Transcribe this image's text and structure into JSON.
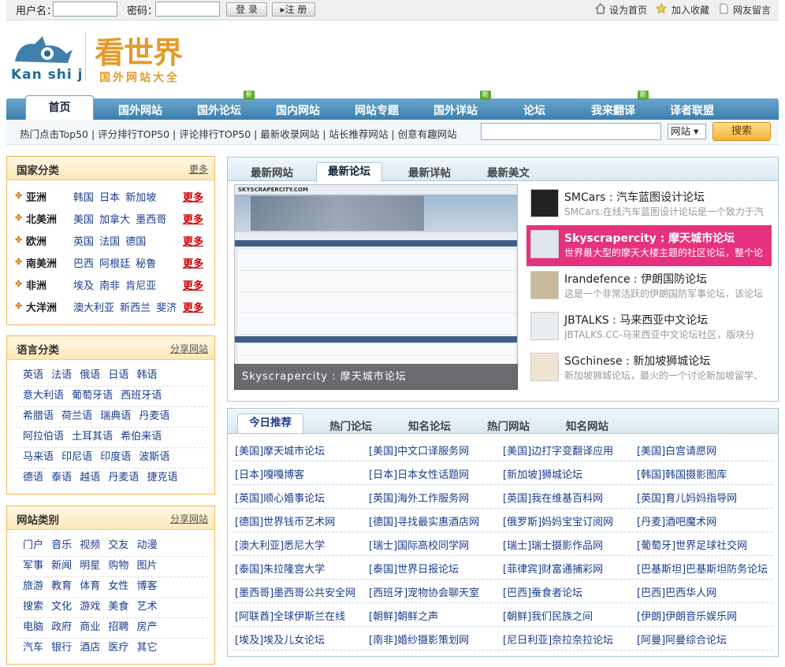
{
  "topbar": {
    "username_label": "用户名：",
    "password_label": "密码：",
    "login_btn": "登 录",
    "register_btn": "▸注 册",
    "set_home": "设为首页",
    "favorite": "加入收藏",
    "guestbook": "网友留言"
  },
  "logo": {
    "en": "Kan shi j",
    "cn": "看世界",
    "sub": "国外网站大全"
  },
  "nav": {
    "home": "首页",
    "items": [
      "国外网站",
      "国外论坛",
      "国内网站",
      "网站专题",
      "国外详站",
      "论坛",
      "我来翻译",
      "译者联盟"
    ],
    "new_tag": "新"
  },
  "subnav": {
    "links": "热门点击Top50 | 评分排行TOP50 | 评论排行TOP50 | 最新收录网站 | 站长推荐网站 | 创意有趣网站",
    "select": "网站 ▾",
    "search_btn": "搜索"
  },
  "country_box": {
    "title": "国家分类",
    "more": "更多",
    "rows": [
      {
        "region": "亚洲",
        "countries": "韩国 日本 新加坡",
        "more": "更多"
      },
      {
        "region": "北美洲",
        "countries": "美国 加拿大 墨西哥",
        "more": "更多"
      },
      {
        "region": "欧洲",
        "countries": "英国 法国 德国",
        "more": "更多"
      },
      {
        "region": "南美洲",
        "countries": "巴西 阿根廷 秘鲁",
        "more": "更多"
      },
      {
        "region": "非洲",
        "countries": "埃及 南非 肯尼亚",
        "more": "更多"
      },
      {
        "region": "大洋洲",
        "countries": "澳大利亚 新西兰 斐济",
        "more": "更多"
      }
    ]
  },
  "language_box": {
    "title": "语言分类",
    "more": "分享网站",
    "rows": [
      "英语 法语 俄语 日语 韩语",
      "意大利语 葡萄牙语 西班牙语",
      "希腊语 荷兰语 瑞典语 丹麦语",
      "阿拉伯语 土耳其语 希伯来语",
      "马来语 印尼语 印度语 波斯语",
      "德语 泰语 越语 丹麦语 捷克语"
    ]
  },
  "sitetype_box": {
    "title": "网站类别",
    "more": "分享网站",
    "rows": [
      "门户 音乐 视频 交友 动漫",
      "军事 新闻 明星 购物 图片",
      "旅游 教育 体育 女性 博客",
      "搜索 文化 游戏 美食 艺术",
      "电脑 政府 商业 招聘 房产",
      "汽车 银行 酒店 医疗 其它"
    ]
  },
  "panel1": {
    "tabs": [
      "最新网站",
      "最新论坛",
      "最新详帖",
      "最新美文"
    ],
    "active_tab": "最新论坛",
    "caption": "Skyscrapercity : 摩天城市论坛",
    "shot_header": "SKYSCRAPERCITY.COM",
    "forums": [
      {
        "title": "SMCars : 汽车蓝图设计论坛",
        "desc": "SMCars:在线汽车蓝图设计论坛是一个致力于汽"
      },
      {
        "title": "Skyscrapercity : 摩天城市论坛",
        "desc": "世界最大型的摩天大楼主题的社区论坛，整个论"
      },
      {
        "title": "Irandefence : 伊朗国防论坛",
        "desc": "这是一个非常活跃的伊朗国防军事论坛，该论坛"
      },
      {
        "title": "JBTALKS : 马来西亚中文论坛",
        "desc": "JBTALKS.CC-马来西亚中文论坛社区，版块分"
      },
      {
        "title": "SGchinese : 新加坡狮城论坛",
        "desc": "新加坡狮城论坛，最火的一个讨论新加坡留学、"
      }
    ]
  },
  "panel2": {
    "tabs": [
      "今日推荐",
      "热门论坛",
      "知名论坛",
      "热门网站",
      "知名网站"
    ],
    "active_tab": "今日推荐",
    "grid": [
      [
        "[美国]摩天城市论坛",
        "[美国]中文口译服务网",
        "[美国]边打字变翻译应用",
        "[美国]白宫请愿网"
      ],
      [
        "[日本]嘎嘎博客",
        "[日本]日本女性话题网",
        "[新加坡]狮城论坛",
        "[韩国]韩国摄影图库"
      ],
      [
        "[英国]顺心婚事论坛",
        "[英国]海外工作服务网",
        "[英国]我在维基百科网",
        "[英国]育儿妈妈指导网"
      ],
      [
        "[德国]世界钱币艺术网",
        "[德国]寻找最实惠酒店网",
        "[俄罗斯]妈妈宝宝订阅网",
        "[丹麦]酒吧魔术网"
      ],
      [
        "[澳大利亚]悉尼大学",
        "[瑞士]国际高校同学网",
        "[瑞士]瑞士摄影作品网",
        "[葡萄牙]世界足球社交网"
      ],
      [
        "[泰国]朱拉隆宫大学",
        "[泰国]世界日报论坛",
        "[菲律宾]财富通捕彩网",
        "[巴基斯坦]巴基斯坦防务论坛"
      ],
      [
        "[墨西哥]墨西哥公共安全网",
        "[西班牙]宠物协会聊天室",
        "[巴西]蚕食者论坛",
        "[巴西]巴西华人网"
      ],
      [
        "[阿联酋]全球伊斯兰在线",
        "[朝鲜]朝鲜之声",
        "[朝鲜]我们民族之间",
        "[伊朗]伊朗音乐娱乐网"
      ],
      [
        "[埃及]埃及儿女论坛",
        "[南非]婚纱摄影策划网",
        "[尼日利亚]奈拉奈拉论坛",
        "[阿曼]阿曼综合论坛"
      ]
    ]
  },
  "colors": {
    "accent": "#e6327e",
    "nav": "#3b7fae",
    "orange": "#f0b65a"
  }
}
